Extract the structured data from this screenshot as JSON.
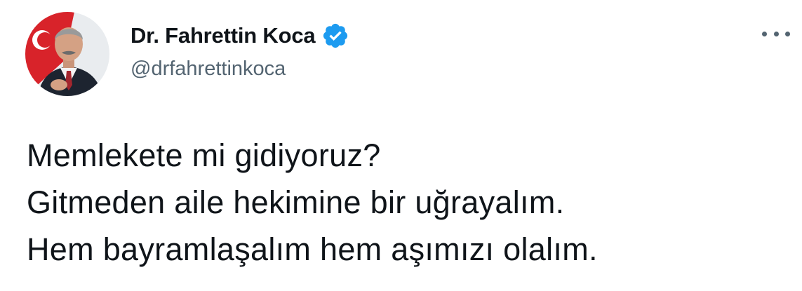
{
  "author": {
    "display_name": "Dr. Fahrettin Koca",
    "handle": "@drfahrettinkoca",
    "verified": true
  },
  "tweet": {
    "lines": [
      "Memlekete mi gidiyoruz?",
      "Gitmeden aile hekimine bir uğrayalım.",
      "Hem bayramlaşalım hem aşımızı olalım."
    ]
  },
  "icons": {
    "verified": "verified-badge-icon",
    "more": "more-options-icon"
  },
  "colors": {
    "text": "#0f1419",
    "secondary": "#536471",
    "verified": "#1d9bf0",
    "background": "#ffffff"
  }
}
